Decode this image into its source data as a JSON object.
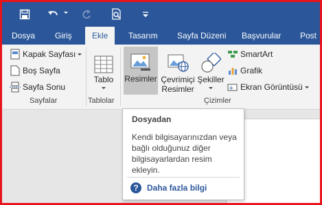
{
  "quick_access": {
    "save_icon": "save-icon",
    "undo_icon": "undo-icon",
    "redo_icon": "redo-icon",
    "print_preview_icon": "print-preview-icon",
    "customize_icon": "customize-toolbar-icon"
  },
  "tabs": [
    {
      "label": "Dosya"
    },
    {
      "label": "Giriş"
    },
    {
      "label": "Ekle"
    },
    {
      "label": "Tasarım"
    },
    {
      "label": "Sayfa Düzeni"
    },
    {
      "label": "Başvurular"
    },
    {
      "label": "Post"
    }
  ],
  "ribbon": {
    "pages_group": {
      "label": "Sayfalar",
      "cover_page": "Kapak Sayfası",
      "blank_page": "Boş Sayfa",
      "page_break": "Sayfa Sonu"
    },
    "tables_group": {
      "label": "Tablolar",
      "table": "Tablo"
    },
    "illustrations_group": {
      "label": "Çizimler",
      "pictures": "Resimler",
      "online_pictures_line1": "Çevrimiçi",
      "online_pictures_line2": "Resimler",
      "shapes": "Şekiller",
      "smartart": "SmartArt",
      "chart": "Grafik",
      "screenshot": "Ekran Görüntüsü"
    }
  },
  "tooltip": {
    "title": "Dosyadan",
    "body": "Kendi bilgisayarınızdan veya bağlı olduğunuz diğer bilgisayarlardan resim ekleyin.",
    "more_info": "Daha fazla bilgi"
  },
  "colors": {
    "accent": "#2b579a",
    "frame": "#e8141c",
    "ribbon_bg": "#f3f3f3"
  }
}
